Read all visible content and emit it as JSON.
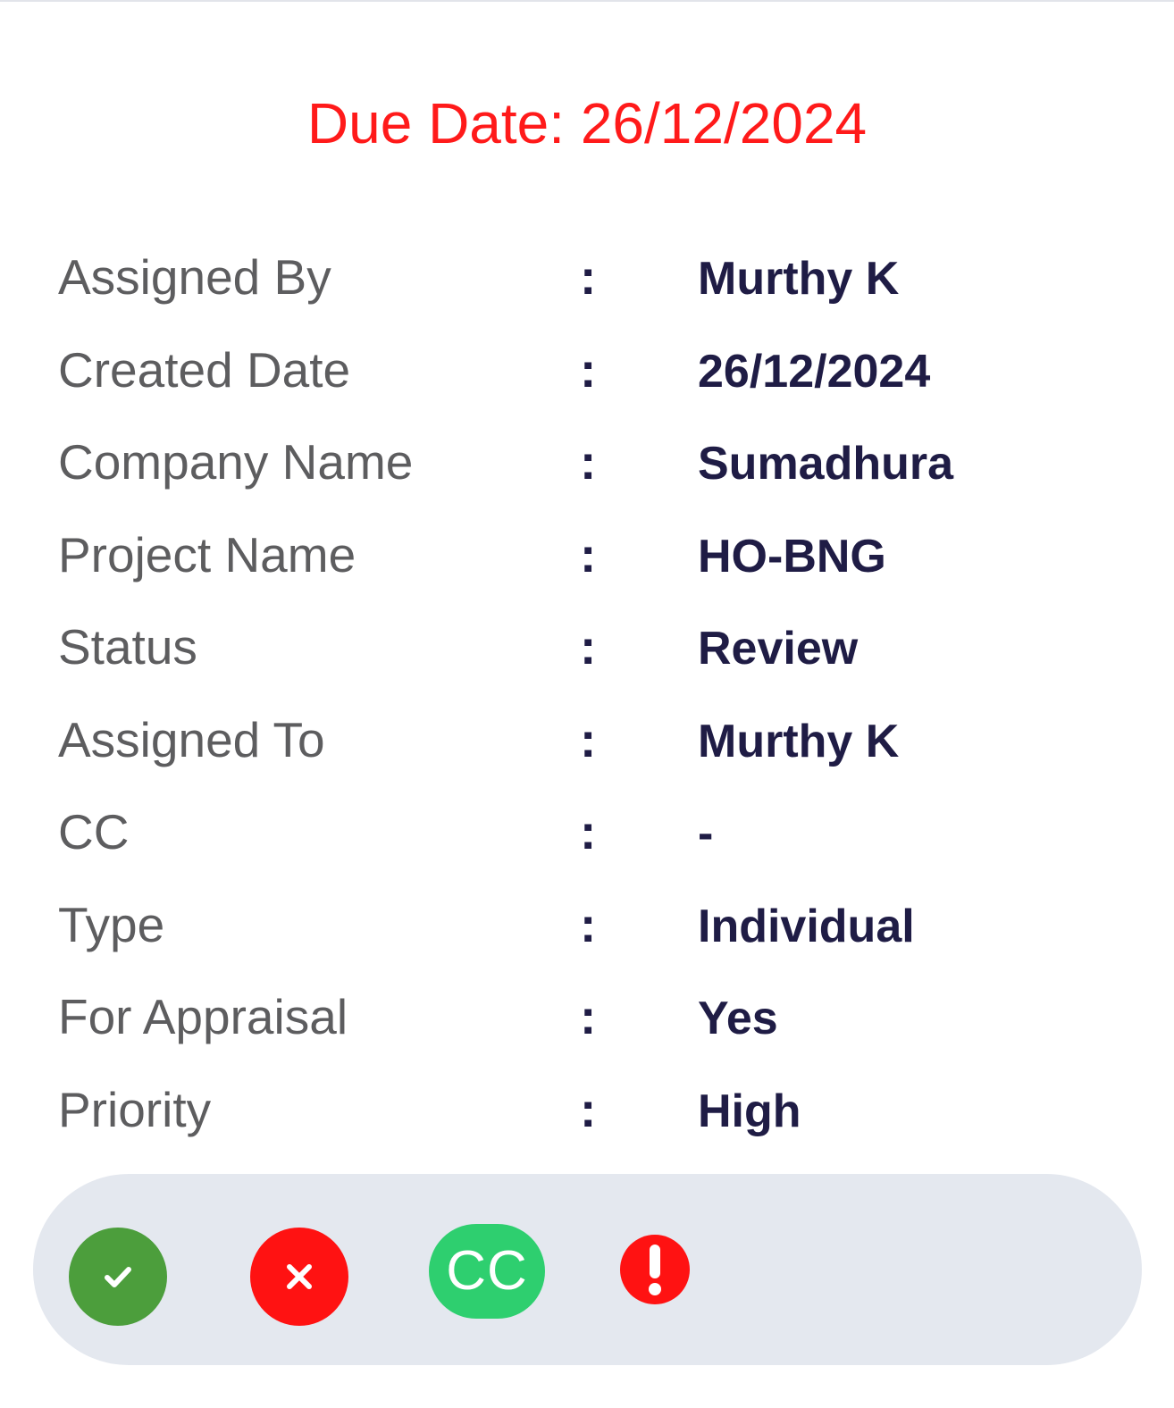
{
  "header": {
    "due_date_text": "Due Date: 26/12/2024"
  },
  "details": [
    {
      "label": "Assigned By",
      "separator": ":",
      "value": "Murthy K"
    },
    {
      "label": "Created Date",
      "separator": ":",
      "value": "26/12/2024"
    },
    {
      "label": "Company Name",
      "separator": ":",
      "value": "Sumadhura"
    },
    {
      "label": "Project Name",
      "separator": ":",
      "value": "HO-BNG"
    },
    {
      "label": "Status",
      "separator": ":",
      "value": "Review"
    },
    {
      "label": "Assigned To",
      "separator": ":",
      "value": "Murthy K"
    },
    {
      "label": "CC",
      "separator": ":",
      "value": "-"
    },
    {
      "label": "Type",
      "separator": ":",
      "value": "Individual"
    },
    {
      "label": "For Appraisal",
      "separator": ":",
      "value": "Yes"
    },
    {
      "label": "Priority",
      "separator": ":",
      "value": "High"
    }
  ],
  "actions": {
    "approve": {
      "icon": "check-icon",
      "color": "#4c9e3c"
    },
    "reject": {
      "icon": "close-icon",
      "color": "#ff1212"
    },
    "cc": {
      "label": "CC",
      "color": "#2ecf6f"
    },
    "alert": {
      "icon": "exclamation-icon",
      "color": "#ff1212"
    }
  },
  "colors": {
    "due_date": "#ff1a1a",
    "label": "#5d5d5f",
    "value": "#1f1c45",
    "action_bar": "#e4e8ef"
  }
}
